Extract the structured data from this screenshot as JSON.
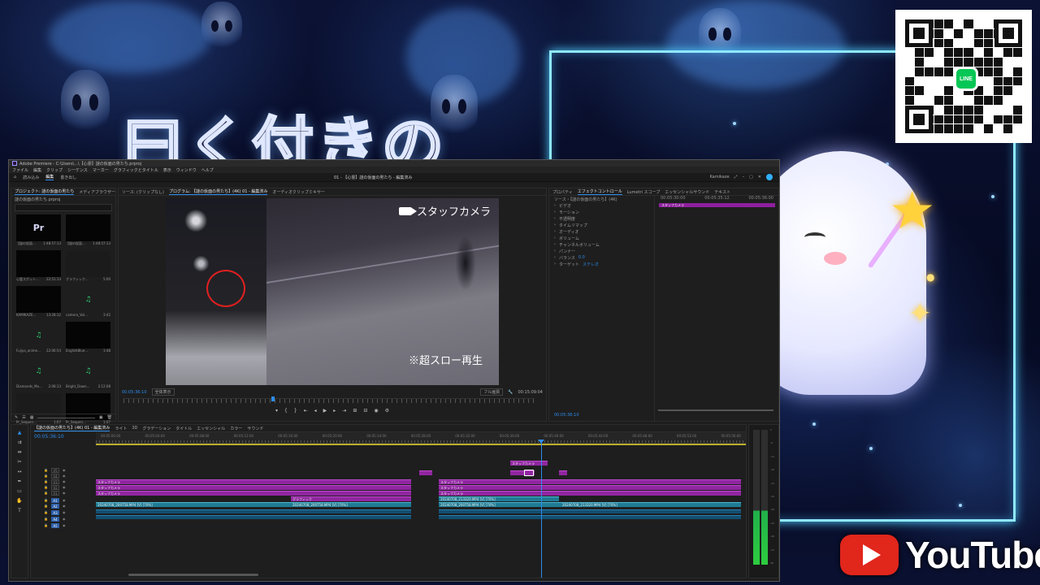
{
  "overlay": {
    "title": "曰く付きの",
    "youtube_text": "YouTube",
    "line_badge": "LINE"
  },
  "premiere": {
    "title_bar": "Adobe Premiere - C:\\Users\\...\\【心霊】謎の仮面の男たち.prproj",
    "menu": [
      "ファイル",
      "編集",
      "クリップ",
      "シーケンス",
      "マーカー",
      "グラフィックとタイトル",
      "表示",
      "ウィンドウ",
      "ヘルプ"
    ],
    "workspace_tabs": [
      "読み込み",
      "編集",
      "書き出し"
    ],
    "center_title": "01 - 【心霊】謎の仮面の男たち - 編集済み",
    "header_right": "Kamikaze",
    "project_panel": {
      "tabs": [
        "プロジェクト: 謎の仮面の男たち",
        "メディアブラウザー"
      ],
      "path": "謎の仮面の男たち.prproj",
      "items": [
        {
          "name": "【謎の仮面...",
          "dur": "1:48:57:13",
          "kind": "pr"
        },
        {
          "name": "【謎の仮面...",
          "dur": "1:48:57:13",
          "kind": "dark"
        },
        {
          "name": "心霊スポット...",
          "dur": "22:51:13",
          "kind": "dark"
        },
        {
          "name": "グラフィック...",
          "dur": "5:00",
          "kind": "light"
        },
        {
          "name": "KAMIKAZE...",
          "dur": "13:28:12",
          "kind": "dark"
        },
        {
          "name": "camera_Vol...",
          "dur": "3:42",
          "kind": "audio"
        },
        {
          "name": "Fujiya_anime...",
          "dur": "22:06:54",
          "kind": "audio"
        },
        {
          "name": "EnglishBlue...",
          "dur": "1:48",
          "kind": "dark"
        },
        {
          "name": "Diamonds_Mo...",
          "dur": "2:08:13",
          "kind": "audio"
        },
        {
          "name": "Bright_Dawn...",
          "dur": "2:12:08",
          "kind": "audio"
        },
        {
          "name": "Pr_Sequen...",
          "dur": "1:07",
          "kind": "light"
        },
        {
          "name": "Pr_Sequen...",
          "dur": "1:07",
          "kind": "dark"
        }
      ]
    },
    "program": {
      "tabs": [
        "ソース: (クリップなし)",
        "プログラム: 【謎の仮面の男たち】(4K) 01 - 編集済み",
        "オーディオクリップミキサー"
      ],
      "camera_label": "スタッフカメラ",
      "slow_label": "※超スロー再生",
      "timecode": "00:05:36:10",
      "fit": "全体表示",
      "quality": "フル画質",
      "duration": "00:15:09:04",
      "playhead_fraction": 0.36
    },
    "effect_controls": {
      "tabs": [
        "プロパティ",
        "エフェクトコントロール",
        "Lumetri スコープ",
        "エッセンシャルサウンド",
        "テキスト"
      ],
      "source": "ソース・【謎の仮面の男たち】(4K)",
      "rows": [
        {
          "label": "ビデオ",
          "value": ""
        },
        {
          "label": "モーション",
          "value": ""
        },
        {
          "label": "不透明度",
          "value": ""
        },
        {
          "label": "タイムリマップ",
          "value": ""
        },
        {
          "label": "オーディオ",
          "value": ""
        },
        {
          "label": "ボリューム",
          "value": ""
        },
        {
          "label": "チャンネルボリューム",
          "value": ""
        },
        {
          "label": "パンナー",
          "value": ""
        },
        {
          "label": "バランス",
          "value": "0.0"
        },
        {
          "label": "ターゲット",
          "value": "ステレオ"
        }
      ],
      "ruler": [
        "00:05:30:00",
        "00:05:35:12",
        "00:05:36:00"
      ],
      "clip_label": "スタッフカメラ",
      "timecode": "00:05:36:10"
    },
    "timeline": {
      "tabs": [
        "【謎の仮面の男たち】(4K) 01 - 編集済み",
        "ライト",
        "3D",
        "グラデーション",
        "タイトル",
        "エッセンシャル",
        "カラー",
        "サウンド"
      ],
      "timecode": "00:05:36:10",
      "ruler": [
        "00:05:00:00",
        "00:05:04:00",
        "00:05:08:00",
        "00:05:12:00",
        "00:05:16:00",
        "00:05:20:00",
        "00:05:24:00",
        "00:05:28:00",
        "00:05:32:00",
        "00:05:36:00",
        "00:05:40:00",
        "00:05:44:00",
        "00:05:48:00",
        "00:05:52:00",
        "00:05:56:00"
      ],
      "tracks": [
        "V5",
        "V4",
        "V3",
        "V2",
        "V1",
        "A1",
        "A2",
        "A3",
        "A4",
        "A5"
      ],
      "clips": {
        "t1": "スタッフカメラ",
        "p1": "スタッフカメラ",
        "p2": "スタッフカメラ",
        "p3": "スタッフカメラ",
        "p4": "スタッフカメラ",
        "p5": "スタッフカメラ",
        "p6": "スタッフカメラ",
        "g1": "グラフィック",
        "v1": "20240708_200758.MP4 [V] [70%]",
        "v2": "20240708_200758.MP4 [V] [70%]",
        "v3": "20240708_213320.MP4 [V] [70%]",
        "v4": "20240708_200758.MP4 [V] [70%]",
        "v5": "20240708_213320.MP4 [V] [70%]"
      },
      "playhead_fraction": 0.685
    },
    "meter_scale": [
      "0",
      "-6",
      "-12",
      "-18",
      "-24",
      "-30",
      "-36",
      "-42",
      "-48",
      "-54",
      "dB"
    ]
  }
}
